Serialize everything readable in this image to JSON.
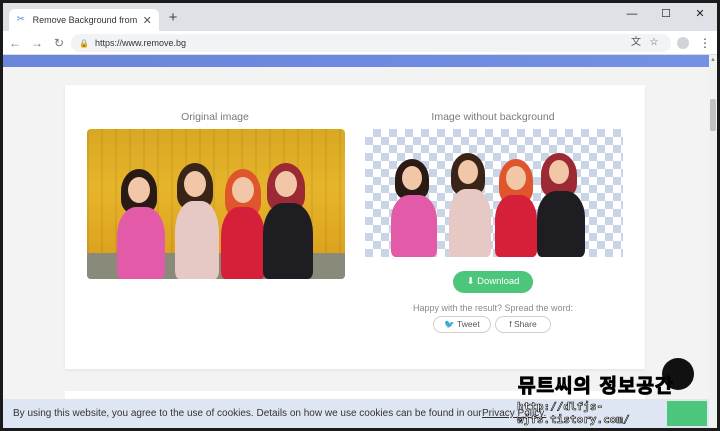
{
  "browser": {
    "tab_title": "Remove Background from Imag",
    "tab_favicon": "scissors-icon",
    "new_tab": "+",
    "url": "https://www.remove.bg",
    "minimize": "—",
    "maximize": "☐",
    "close": "✕"
  },
  "main": {
    "original_title": "Original image",
    "nobg_title": "Image without background",
    "download_label": "Download",
    "share_prompt": "Happy with the result? Spread the word:",
    "tweet_label": "Tweet",
    "share_label": "Share"
  },
  "cookie": {
    "text": "By using this website, you agree to the use of cookies. Details on how we use cookies can be found in our",
    "link": "Privacy Policy."
  },
  "watermark": {
    "title": "뮤트씨의 정보공간",
    "url": "http://dlfjs-wjfs.tistory.com/"
  },
  "colors": {
    "accent_green": "#4cc67a",
    "banner_blue": "#6d8ae0",
    "cookie_bg": "#dfe6f3"
  }
}
